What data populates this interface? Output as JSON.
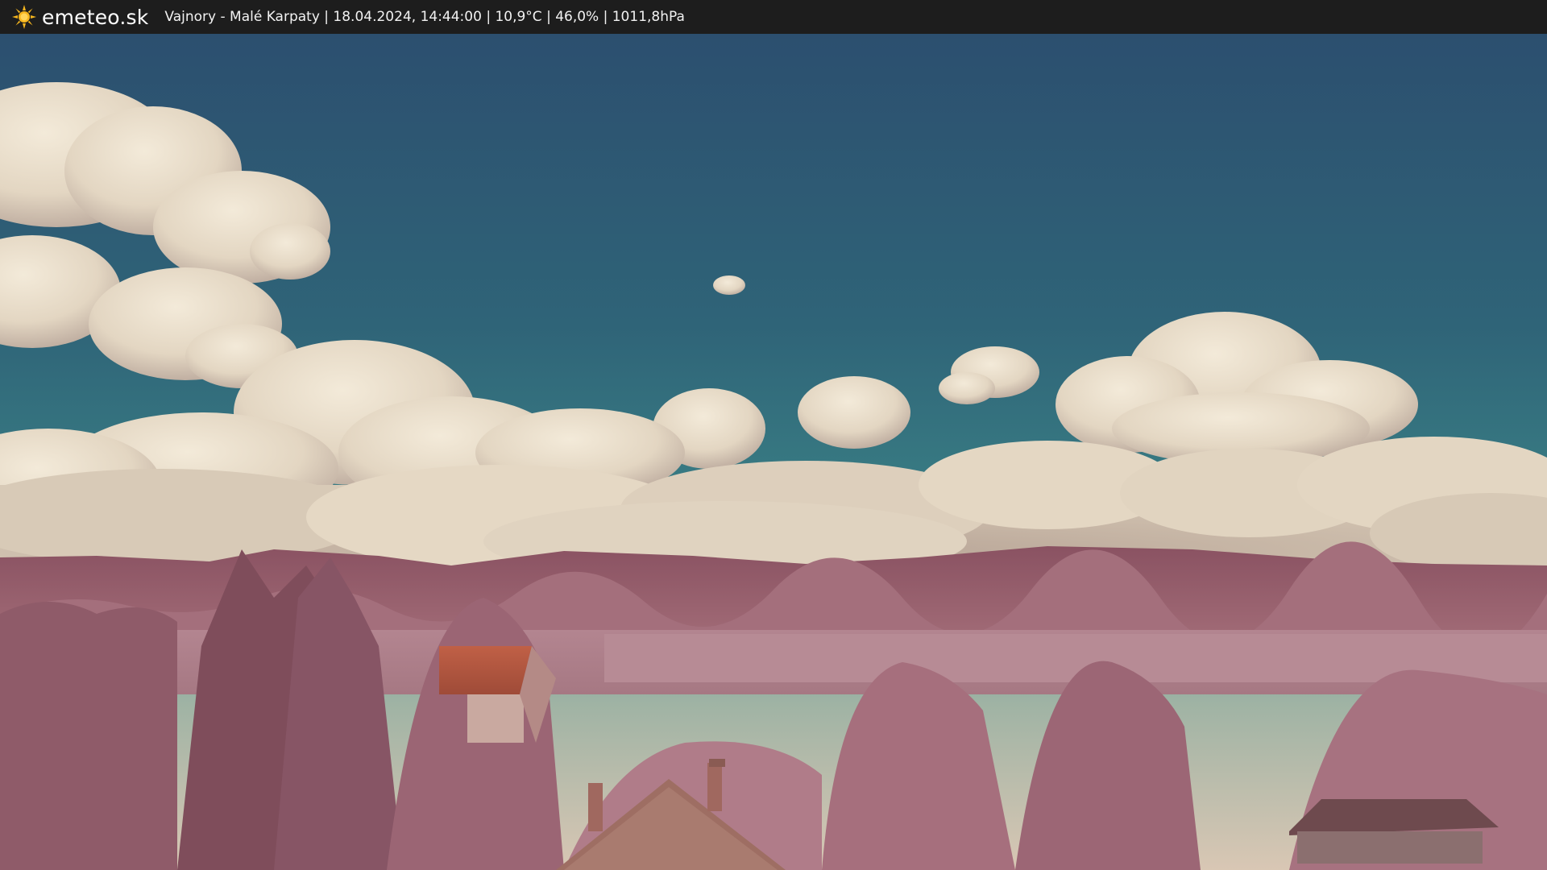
{
  "header": {
    "brand": "emeteo.sk",
    "logo_icon": "sun-icon",
    "caption": "Vajnory - Malé Karpaty | 18.04.2024, 14:44:00 | 10,9°C | 46,0% | 1011,8hPa"
  },
  "webcam": {
    "view": "infrared-style sky with cumulus clouds over hills, trees and rooftops"
  },
  "colors": {
    "bar_bg": "#1d1d1d",
    "sun": "#f5b51e",
    "sky_top": "#2d5473",
    "sky_mid": "#2e6d7c",
    "cloud": "#e9ddc8",
    "hills": "#8f5866",
    "foliage": "#a06a79",
    "roof": "#b9573f"
  }
}
